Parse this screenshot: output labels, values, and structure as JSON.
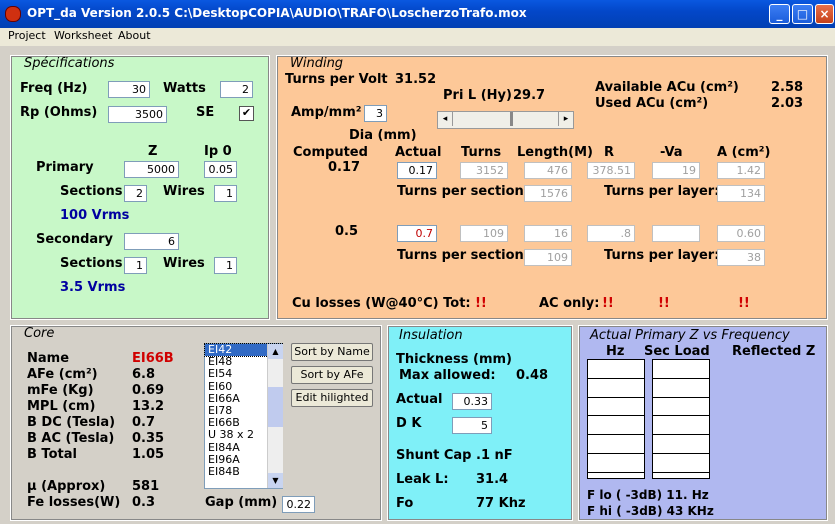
{
  "window": {
    "title": "OPT_da Version 2.0.5   C:\\DesktopCOPIA\\AUDIO\\TRAFO\\LoscherzoTrafo.mox"
  },
  "menu": [
    "Project",
    "Worksheet",
    "About"
  ],
  "spec": {
    "title": "Spécifications",
    "freq_label": "Freq (Hz)",
    "freq": "30",
    "watts_label": "Watts",
    "watts": "2",
    "rp_label": "Rp (Ohms)",
    "rp": "3500",
    "se_label": "SE",
    "se_check": "✔",
    "z_label": "Z",
    "ip0_label": "Ip 0",
    "primary_label": "Primary",
    "primary_z": "5000",
    "primary_ip0": "0.05",
    "sections_label": "Sections",
    "wires_label": "Wires",
    "primary_sections": "2",
    "primary_wires": "1",
    "primary_vrms": "100 Vrms",
    "secondary_label": "Secondary",
    "secondary_z": "6",
    "secondary_sections": "1",
    "secondary_wires": "1",
    "secondary_vrms": "3.5 Vrms"
  },
  "winding": {
    "title": "Winding",
    "tpv_label": "Turns per Volt",
    "tpv": "31.52",
    "pril_label": "Pri L (Hy)",
    "pril": "29.7",
    "avail_label": "Available ACu (cm²)",
    "avail": "2.58",
    "used_label": "Used ACu (cm²)",
    "used": "2.03",
    "amp_label": "Amp/mm²",
    "amp": "3",
    "dia_label": "Dia (mm)",
    "hdr_computed": "Computed",
    "hdr_actual": "Actual",
    "hdr_turns": "Turns",
    "hdr_length": "Length(M)",
    "hdr_r": "R",
    "hdr_va": "-Va",
    "hdr_a": "A (cm²)",
    "row1": {
      "computed": "0.17",
      "actual": "0.17",
      "turns": "3152",
      "length": "476",
      "r": "378.51",
      "va": "19",
      "a": "1.42",
      "tps": "1576",
      "tpl": "134"
    },
    "row2": {
      "computed": "0.5",
      "actual": "0.7",
      "turns": "109",
      "length": "16",
      "r": ".8",
      "va": "",
      "a": "0.60",
      "tps": "109",
      "tpl": "38"
    },
    "tps_label": "Turns per section:",
    "tpl_label": "Turns per layer:",
    "culoss_label": "Cu losses (W@40°C) Tot:",
    "culoss_tot": "!!",
    "aconly_label": "AC only:",
    "ac1": "!!",
    "ac2": "!!",
    "ac3": "!!"
  },
  "core": {
    "title": "Core",
    "name_label": "Name",
    "name": "EI66B",
    "afe_label": "AFe (cm²)",
    "afe": "6.8",
    "mfe_label": "mFe (Kg)",
    "mfe": "0.69",
    "mpl_label": "MPL (cm)",
    "mpl": "13.2",
    "bdc_label": "B DC (Tesla)",
    "bdc": "0.7",
    "bac_label": "B AC (Tesla)",
    "bac": "0.35",
    "btot_label": "B Total",
    "btot": "1.05",
    "mu_label": "µ (Approx)",
    "mu": "581",
    "feloss_label": "Fe losses(W)",
    "feloss": "0.3",
    "list": [
      "EI42",
      "EI48",
      "EI54",
      "EI60",
      "EI66A",
      "EI78",
      "EI66B",
      "U 38 x 2",
      "EI84A",
      "EI96A",
      "EI84B"
    ],
    "selected": "EI42",
    "sort_name": "Sort by Name",
    "sort_afe": "Sort by AFe",
    "edit": "Edit hilighted",
    "gap_label": "Gap (mm)",
    "gap": "0.22"
  },
  "insulation": {
    "title": "Insulation",
    "thick_label": "Thickness (mm)",
    "maxallowed_label": "Max allowed:",
    "maxallowed": "0.48",
    "actual_label": "Actual",
    "actual": "0.33",
    "dk_label": "D K",
    "dk": "5",
    "shunt_label": "Shunt Cap",
    "shunt": ".1 nF",
    "leak_label": "Leak L:",
    "leak": "31.4",
    "fo_label": "Fo",
    "fo": "77 Khz"
  },
  "freq": {
    "title": "Actual Primary Z vs Frequency",
    "hz_label": "Hz",
    "secload_label": "Sec Load",
    "refl_label": "Reflected Z",
    "flo": "F lo ( -3dB) 11. Hz",
    "fhi": "F hi ( -3dB)   43 KHz"
  }
}
